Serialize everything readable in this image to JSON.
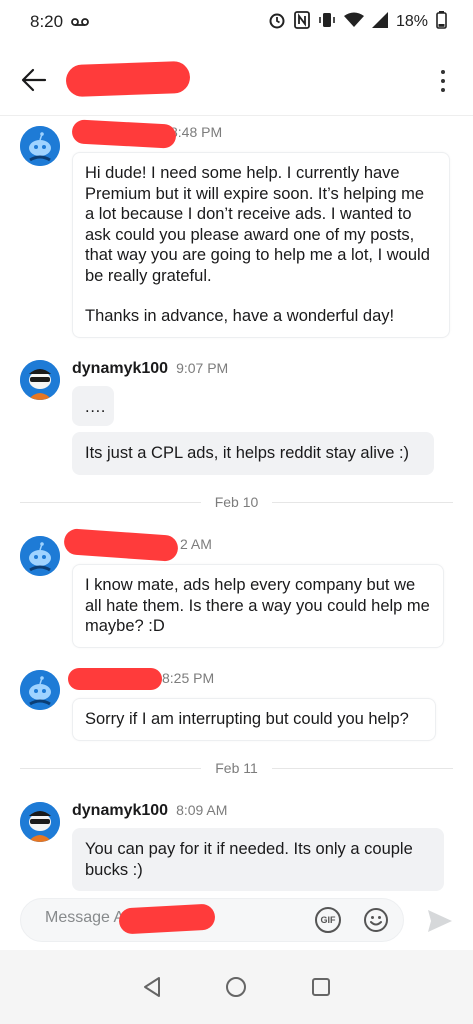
{
  "status_bar": {
    "time": "8:20",
    "battery": "18%"
  },
  "header": {
    "title": "",
    "back_icon": "arrow-left-icon",
    "menu_icon": "vertical-dots-icon"
  },
  "messages": [
    {
      "sender": "",
      "time": "8:48 PM",
      "avatar": "snoo-avatar-blue",
      "bubbles": [
        {
          "paragraphs": [
            "Hi dude! I need some help. I currently have Premium but it will expire soon. It’s helping me a lot because I don’t receive ads. I wanted to ask could you please award one of my posts, that way you are going to help me a lot, I would be really grateful.",
            "Thanks in advance, have a wonderful day!"
          ]
        }
      ]
    },
    {
      "sender": "dynamyk100",
      "time": "9:07 PM",
      "avatar": "snoo-avatar-sunglasses",
      "bubbles": [
        {
          "paragraphs": [
            ".…"
          ]
        },
        {
          "paragraphs": [
            "Its just a CPL ads, it helps reddit stay alive :)"
          ]
        }
      ]
    },
    {
      "sender": "",
      "time": "2 AM",
      "avatar": "snoo-avatar-blue",
      "bubbles": [
        {
          "paragraphs": [
            "I know mate, ads help every company but we all hate them. Is there a way you could help me maybe? :D"
          ]
        }
      ]
    },
    {
      "sender": "",
      "time": "8:25 PM",
      "avatar": "snoo-avatar-blue",
      "bubbles": [
        {
          "paragraphs": [
            "Sorry if I am interrupting but could you help?"
          ]
        }
      ]
    },
    {
      "sender": "dynamyk100",
      "time": "8:09 AM",
      "avatar": "snoo-avatar-sunglasses",
      "bubbles": [
        {
          "paragraphs": [
            "You can pay for it if needed. Its only a couple bucks :)"
          ]
        }
      ]
    }
  ],
  "dividers": [
    "Feb 10",
    "Feb 11"
  ],
  "composer": {
    "placeholder": "Message A",
    "gif_label": "GIF"
  },
  "colors": {
    "redaction": "#ff3b3b",
    "avatar_blue": "#1e7bd6",
    "outgoing_bubble": "#f1f2f4"
  }
}
